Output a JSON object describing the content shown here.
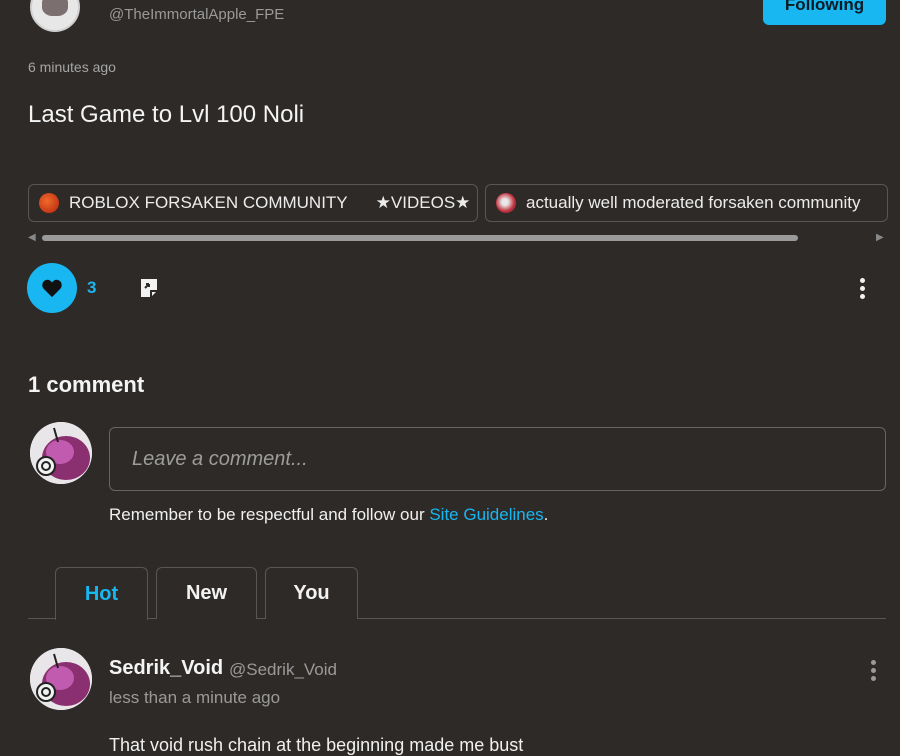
{
  "post": {
    "handle": "@TheImmortalApple_FPE",
    "follow_label": "Following",
    "time_ago": "6 minutes ago",
    "title": "Last Game to Lvl 100 Noli",
    "communities": [
      {
        "label": "ROBLOX FORSAKEN COMMUNITY      ★VIDEOS★"
      },
      {
        "label": "actually well moderated forsaken community"
      }
    ],
    "like_count": "3"
  },
  "comments": {
    "heading": "1 comment",
    "input_placeholder": "Leave a comment...",
    "guidelines_prefix": "Remember to be respectful and follow our ",
    "guidelines_link": "Site Guidelines",
    "guidelines_suffix": ".",
    "tabs": [
      {
        "label": "Hot"
      },
      {
        "label": "New"
      },
      {
        "label": "You"
      }
    ],
    "items": [
      {
        "author": "Sedrik_Void",
        "handle": "@Sedrik_Void",
        "time_ago": "less than a minute ago",
        "text": "That void rush chain at the beginning made me bust"
      }
    ]
  },
  "colors": {
    "background": "#2e2a27",
    "accent": "#18b7f2",
    "border": "#5b5652"
  },
  "icons": [
    "heart-icon",
    "share-icon",
    "more-vertical-icon",
    "scroll-arrow-left-icon",
    "scroll-arrow-right-icon"
  ]
}
